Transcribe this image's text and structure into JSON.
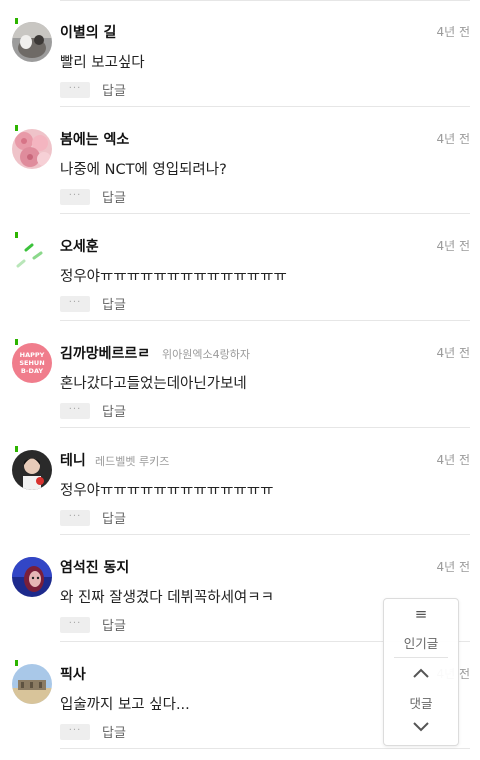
{
  "comments": [
    {
      "name": "이별의 길",
      "sub": "",
      "time": "4년 전",
      "text": "빨리 보고싶다",
      "more": "···",
      "reply": "답글",
      "avatar": "photo-dog-avatar"
    },
    {
      "name": "봄에는 엑소",
      "sub": "",
      "time": "4년 전",
      "text": "나중에 NCT에 영입되려나?",
      "more": "···",
      "reply": "답글",
      "avatar": "pink-flowers-avatar"
    },
    {
      "name": "오세훈",
      "sub": "",
      "time": "4년 전",
      "text": "정우야ㅠㅠㅠㅠㅠㅠㅠㅠㅠㅠㅠㅠㅠㅠ",
      "more": "···",
      "reply": "답글",
      "avatar": "green-dashes-avatar"
    },
    {
      "name": "김까망베르르ㄹ",
      "sub": "위아원엑소4랑하자",
      "time": "4년 전",
      "text": "혼나갔다고들었는데아닌가보네",
      "more": "···",
      "reply": "답글",
      "avatar": "happy-sehun-day-avatar",
      "avatar_text": [
        "HAPPY",
        "SEHUN",
        "B-DAY"
      ]
    },
    {
      "name": "테니",
      "sub": "레드벨벳 루키즈",
      "time": "4년 전",
      "text": "정우야ㅠㅠㅠㅠㅠㅠㅠㅠㅠㅠㅠㅠㅠ",
      "more": "···",
      "reply": "답글",
      "avatar": "person-photo-avatar"
    },
    {
      "name": "염석진 동지",
      "sub": "",
      "time": "4년 전",
      "text": "와 진짜 잘생겼다 데뷔꼭하세여ㅋㅋ",
      "more": "···",
      "reply": "답글",
      "avatar": "blue-portrait-avatar"
    },
    {
      "name": "픽사",
      "sub": "",
      "time": "4년 전",
      "text": "입술까지 보고 싶다...",
      "more": "···",
      "reply": "답글",
      "avatar": "landscape-avatar"
    }
  ],
  "float_nav": {
    "menu_icon": "≡",
    "popular_label": "인기글",
    "comments_label": "댓글"
  },
  "colors": {
    "accent_green": "#2db400",
    "divider": "#e6e6e6",
    "muted_text": "#9a9a9a"
  }
}
